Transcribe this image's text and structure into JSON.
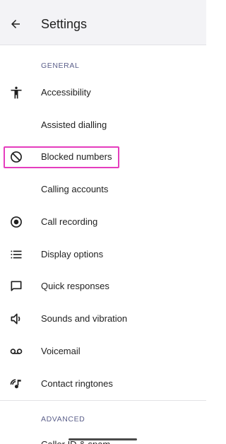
{
  "header": {
    "title": "Settings"
  },
  "sections": {
    "general": "GENERAL",
    "advanced": "ADVANCED"
  },
  "items": [
    {
      "label": "Accessibility",
      "icon": "accessibility-icon"
    },
    {
      "label": "Assisted dialling",
      "icon": ""
    },
    {
      "label": "Blocked numbers",
      "icon": "block-icon"
    },
    {
      "label": "Calling accounts",
      "icon": ""
    },
    {
      "label": "Call recording",
      "icon": "record-icon"
    },
    {
      "label": "Display options",
      "icon": "list-icon"
    },
    {
      "label": "Quick responses",
      "icon": "message-icon"
    },
    {
      "label": "Sounds and vibration",
      "icon": "volume-icon"
    },
    {
      "label": "Voicemail",
      "icon": "voicemail-icon"
    },
    {
      "label": "Contact ringtones",
      "icon": "ringtone-icon"
    }
  ],
  "advanced_items": [
    {
      "label": "Caller ID & spam"
    }
  ],
  "colors": {
    "highlight": "#e53dbe",
    "appbar": "#f3f3f6",
    "section": "#5b5f8a"
  }
}
